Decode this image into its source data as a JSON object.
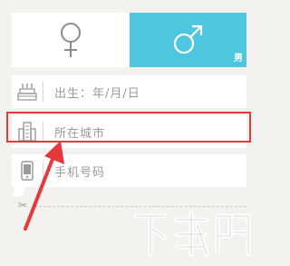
{
  "gender": {
    "female_icon": "female-symbol-icon",
    "male_icon": "male-symbol-icon",
    "male_label": "男",
    "selected": "male",
    "accent_color": "#4ec6dd"
  },
  "fields": {
    "birth": {
      "placeholder": "出生：年/月/日",
      "icon": "birthday-cake-icon"
    },
    "city": {
      "placeholder": "所在城市",
      "icon": "building-icon"
    },
    "phone": {
      "placeholder": "手机号码",
      "icon": "mobile-phone-icon"
    }
  },
  "annotation": {
    "highlight_color": "#e63a3a",
    "arrow_icon": "red-arrow-icon"
  },
  "divider_icon": "scissors-icon",
  "watermark": {
    "icon": "download-site-watermark-logo",
    "text": "下载吧"
  }
}
